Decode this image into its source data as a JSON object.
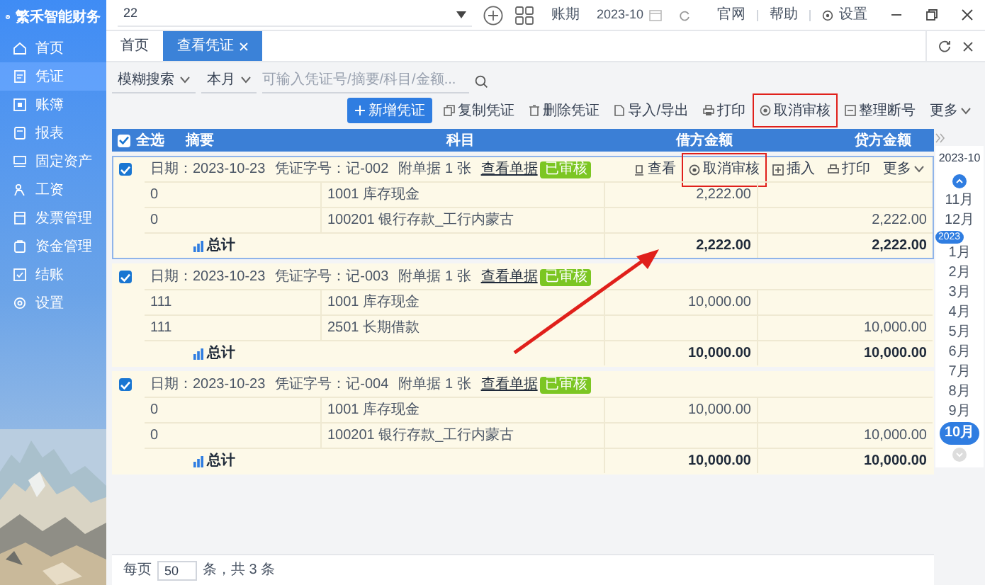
{
  "app": {
    "logo": "繁禾智能财务"
  },
  "sidebar": {
    "items": [
      {
        "label": "首页",
        "selected": false
      },
      {
        "label": "凭证",
        "selected": true
      },
      {
        "label": "账簿",
        "selected": false
      },
      {
        "label": "报表",
        "selected": false
      },
      {
        "label": "固定资产",
        "selected": false
      },
      {
        "label": "工资",
        "selected": false
      },
      {
        "label": "发票管理",
        "selected": false
      },
      {
        "label": "资金管理",
        "selected": false
      },
      {
        "label": "结账",
        "selected": false
      },
      {
        "label": "设置",
        "selected": false
      }
    ]
  },
  "top_bar": {
    "company": "22",
    "period_label": "账期",
    "period": "2023-10",
    "links": [
      "官网",
      "帮助",
      "设置"
    ]
  },
  "tabs": [
    {
      "label": "首页",
      "selected": false,
      "closable": false
    },
    {
      "label": "查看凭证",
      "selected": true,
      "closable": true
    }
  ],
  "toolbar": {
    "filters": [
      "模糊搜索",
      "本月"
    ],
    "search_placeholder": "可输入凭证号/摘要/科目/金额...",
    "buttons": [
      {
        "label": "新增凭证",
        "kind": "primary"
      },
      {
        "label": "复制凭证",
        "kind": "plain"
      },
      {
        "label": "删除凭证",
        "kind": "plain"
      },
      {
        "label": "导入/导出",
        "kind": "plain"
      },
      {
        "label": "打印",
        "kind": "plain"
      },
      {
        "label": "取消审核",
        "kind": "plain",
        "annotated": true
      },
      {
        "label": "整理断号",
        "kind": "plain"
      },
      {
        "label": "更多",
        "kind": "menu"
      }
    ]
  },
  "table": {
    "select_all": {
      "label": "全选",
      "checked": true
    },
    "columns": [
      "摘要",
      "科目",
      "借方金额",
      "贷方金额"
    ]
  },
  "vouchers": [
    {
      "checked": true,
      "selected": true,
      "date": "日期：2023-10-23",
      "number": "凭证字号：记-002",
      "attachments": "附单据 1 张",
      "view_link": "查看单据",
      "status": "已审核",
      "actions": [
        {
          "label": "查看",
          "kind": "plain"
        },
        {
          "label": "取消审核",
          "kind": "plain",
          "annotated": true
        },
        {
          "label": "插入",
          "kind": "plain"
        },
        {
          "label": "打印",
          "kind": "plain"
        },
        {
          "label": "更多",
          "kind": "menu"
        }
      ],
      "entries": [
        {
          "summary": "0",
          "account": "1001 库存现金",
          "debit": "2,222.00"
        },
        {
          "summary": "0",
          "account": "100201 银行存款_工行内蒙古",
          "credit": "2,222.00"
        }
      ],
      "total_label": "总计",
      "total_debit": "2,222.00",
      "total_credit": "2,222.00"
    },
    {
      "checked": true,
      "selected": false,
      "date": "日期：2023-10-23",
      "number": "凭证字号：记-003",
      "attachments": "附单据 1 张",
      "view_link": "查看单据",
      "status": "已审核",
      "entries": [
        {
          "summary": "111",
          "account": "1001 库存现金",
          "debit": "10,000.00"
        },
        {
          "summary": "111",
          "account": "2501 长期借款",
          "credit": "10,000.00"
        }
      ],
      "total_label": "总计",
      "total_debit": "10,000.00",
      "total_credit": "10,000.00"
    },
    {
      "checked": true,
      "selected": false,
      "date": "日期：2023-10-23",
      "number": "凭证字号：记-004",
      "attachments": "附单据 1 张",
      "view_link": "查看单据",
      "status": "已审核",
      "entries": [
        {
          "summary": "0",
          "account": "1001 库存现金",
          "debit": "10,000.00"
        },
        {
          "summary": "0",
          "account": "100201 银行存款_工行内蒙古",
          "credit": "10,000.00"
        }
      ],
      "total_label": "总计",
      "total_debit": "10,000.00",
      "total_credit": "10,000.00"
    }
  ],
  "pagination": {
    "per_page_label": "每页",
    "per_page": "50",
    "summary": "条，共 3 条"
  },
  "calendar": {
    "current": "2023-10",
    "items": [
      {
        "kind": "month",
        "label": "11月",
        "selected": false
      },
      {
        "kind": "month",
        "label": "12月",
        "selected": false
      },
      {
        "kind": "year",
        "label": "2023"
      },
      {
        "kind": "month",
        "label": "1月",
        "selected": false
      },
      {
        "kind": "month",
        "label": "2月",
        "selected": false
      },
      {
        "kind": "month",
        "label": "3月",
        "selected": false
      },
      {
        "kind": "month",
        "label": "4月",
        "selected": false
      },
      {
        "kind": "month",
        "label": "5月",
        "selected": false
      },
      {
        "kind": "month",
        "label": "6月",
        "selected": false
      },
      {
        "kind": "month",
        "label": "7月",
        "selected": false
      },
      {
        "kind": "month",
        "label": "8月",
        "selected": false
      },
      {
        "kind": "month",
        "label": "9月",
        "selected": false
      },
      {
        "kind": "month",
        "label": "10月",
        "selected": true
      }
    ]
  }
}
